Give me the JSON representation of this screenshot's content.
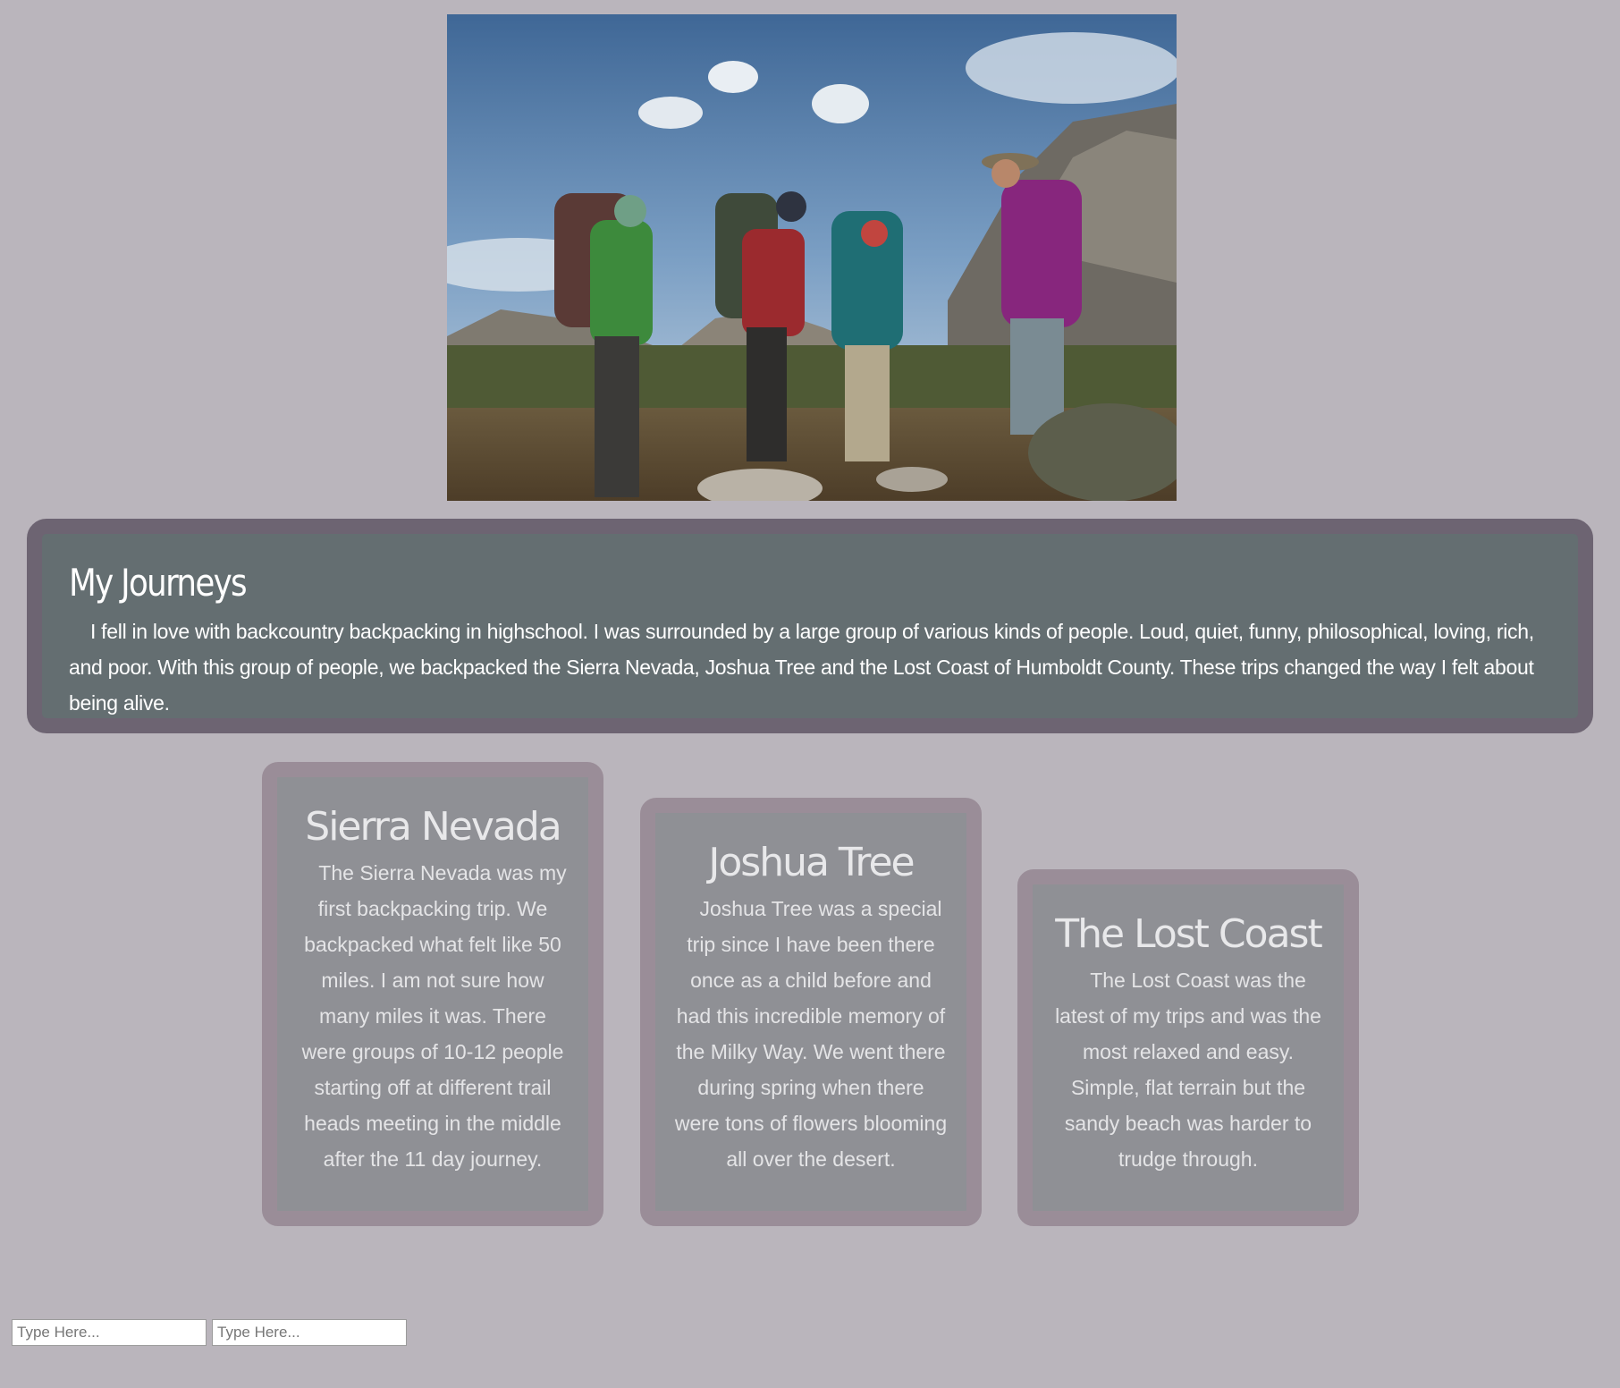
{
  "hero": {
    "image_description_icon": "hikers-photo"
  },
  "intro": {
    "title": "My Journeys",
    "text": "I fell in love with backcountry backpacking in highschool. I was surrounded by a large group of various kinds of people. Loud, quiet, funny, philosophical, loving, rich, and poor. With this group of people, we backpacked the Sierra Nevada, Joshua Tree and the Lost Coast of Humboldt County. These trips changed the way I felt about being alive."
  },
  "cards": [
    {
      "title": "Sierra Nevada",
      "text": "The Sierra Nevada was my first backpacking trip. We backpacked what felt like 50 miles. I am not sure how many miles it was. There were groups of 10-12 people starting off at different trail heads meeting in the middle after the 11 day journey."
    },
    {
      "title": "Joshua Tree",
      "text": "Joshua Tree was a special trip since I have been there once as a child before and had this incredible memory of the Milky Way. We went there during spring when there were tons of flowers blooming all over the desert."
    },
    {
      "title": "The Lost Coast",
      "text": "The Lost Coast was the latest of my trips and was the most relaxed and easy. Simple, flat terrain but the sandy beach was harder to trudge through."
    }
  ],
  "form": {
    "input1_placeholder": "Type Here...",
    "input2_placeholder": "Type Here..."
  },
  "colors": {
    "page_bg": "#bab5bc",
    "intro_bg": "#646e71",
    "intro_border": "#6d6472",
    "card_bg": "#8f9095",
    "card_border": "#9a8d98"
  }
}
